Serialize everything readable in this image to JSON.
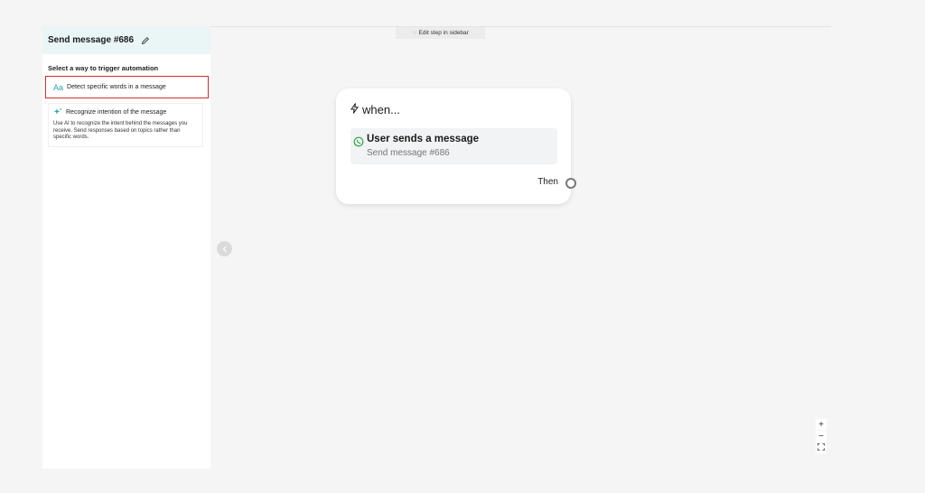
{
  "sidebar": {
    "title": "Send message #686",
    "section_label": "Select a way to trigger automation",
    "options": [
      {
        "label": "Detect specific words in a message",
        "icon": "text-aa-icon",
        "selected": true
      },
      {
        "label": "Recognize intention of the message",
        "icon": "sparkle-icon",
        "description": "Use AI to recognize the intent behind the messages you receive. Send responses based on topics rather than specific words."
      }
    ]
  },
  "canvas": {
    "hint": "Edit step in sidebar",
    "card": {
      "when_label": "when...",
      "trigger_title": "User sends a message",
      "trigger_subtitle": "Send message #686",
      "then_label": "Then"
    },
    "zoom": {
      "in": "+",
      "out": "−"
    }
  },
  "colors": {
    "accent": "#2aa5a5",
    "highlight_border": "#d42b2b",
    "whatsapp": "#25a244"
  }
}
